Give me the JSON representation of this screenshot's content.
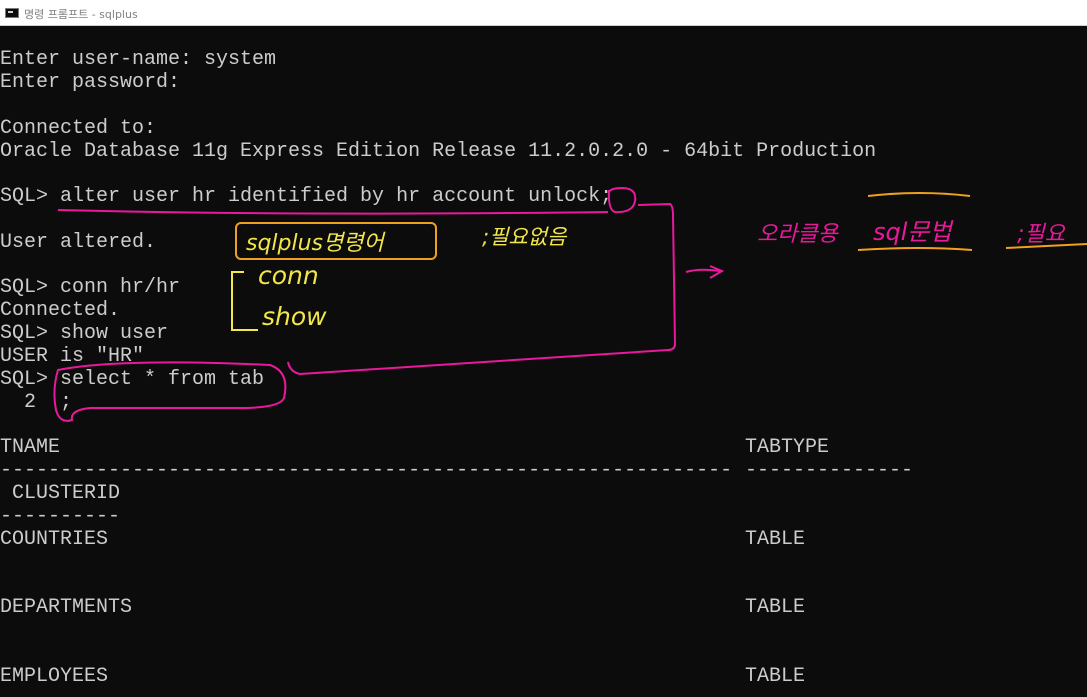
{
  "window": {
    "title": "명령 프롬프트 - sqlplus",
    "icon": "cmd-icon"
  },
  "console": {
    "lines": [
      "Enter user-name: system",
      "Enter password:",
      "Connected to:",
      "Oracle Database 11g Express Edition Release 11.2.0.2.0 - 64bit Production",
      "SQL> alter user hr identified by hr account unlock;",
      "User altered.",
      "SQL> conn hr/hr",
      "Connected.",
      "SQL> show user",
      "USER is \"HR\"",
      "SQL> select * from tab",
      "  2  ;"
    ],
    "table": {
      "headers": [
        "TNAME",
        "TABTYPE",
        " CLUSTERID"
      ],
      "sep_tname": "-------------------------------------------------------------",
      "sep_tabtype": "--------------",
      "sep_clusterid": "----------",
      "rows": [
        {
          "tname": "COUNTRIES",
          "tabtype": "TABLE"
        },
        {
          "tname": "DEPARTMENTS",
          "tabtype": "TABLE"
        },
        {
          "tname": "EMPLOYEES",
          "tabtype": "TABLE"
        }
      ]
    }
  },
  "annotations": {
    "sqlplus_note": "sqlplus명령어",
    "no_semicolon_note": ";필요없음",
    "cmd_conn": "conn",
    "cmd_show": "show",
    "oracle_note": "오라클용",
    "sql_syntax": "sql문법",
    "semicolon_required": ";필요",
    "colors": {
      "pink": "#e8199b",
      "orange": "#f0a020",
      "yellow": "#f2e64a"
    }
  }
}
